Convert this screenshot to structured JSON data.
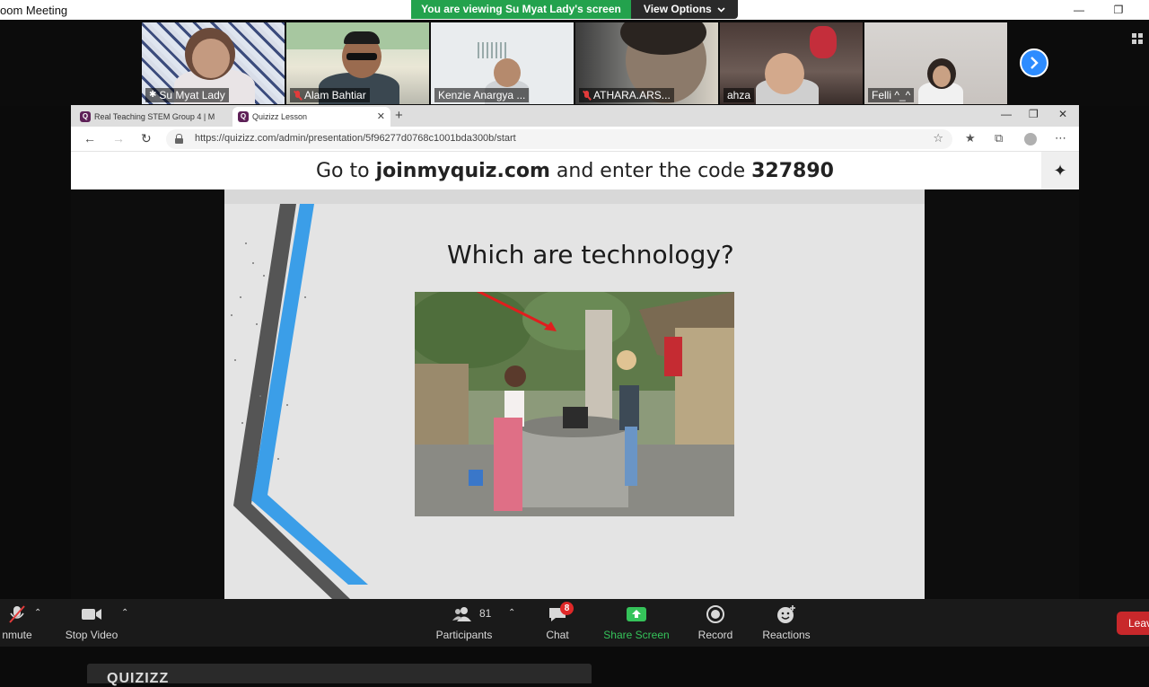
{
  "window": {
    "title": "oom Meeting",
    "minimize_glyph": "—",
    "restore_glyph": "❐"
  },
  "share_banner": {
    "text": "You are viewing Su Myat Lady's screen",
    "view_options": "View Options",
    "view_options_icon": "chevron-down"
  },
  "participants": [
    {
      "name": "Su Myat Lady",
      "muted": false,
      "pinned": true,
      "active_speaker": true
    },
    {
      "name": "Alam Bahtiar",
      "muted": true
    },
    {
      "name": "Kenzie Anargya ...",
      "muted": false
    },
    {
      "name": "ATHARA.ARS...",
      "muted": true
    },
    {
      "name": "ahza",
      "muted": false
    },
    {
      "name": "Felli ^_^",
      "muted": false
    }
  ],
  "strip_next_button_icon": "chevron-right",
  "browser": {
    "tabs": [
      {
        "title": "Real Teaching STEM Group 4 | M",
        "active": false
      },
      {
        "title": "Quizizz Lesson",
        "active": true
      }
    ],
    "tab_favicon_letter": "Q",
    "url": "https://quizizz.com/admin/presentation/5f96277d0768c1001bda300b/start",
    "window_glyphs": {
      "minimize": "—",
      "maximize": "❐",
      "close": "✕"
    }
  },
  "quiz": {
    "join_prefix": "Go to ",
    "join_site": "joinmyquiz.com",
    "join_middle": " and enter the code ",
    "join_code": "327890",
    "slide_title": "Which are technology?",
    "logo_text": "QUIZIZZ"
  },
  "controls": {
    "mute_label": "nmute",
    "video_label": "Stop Video",
    "participants_label": "Participants",
    "participants_count": "81",
    "chat_label": "Chat",
    "chat_badge": "8",
    "share_label": "Share Screen",
    "record_label": "Record",
    "reactions_label": "Reactions",
    "leave_label": "Leav"
  },
  "colors": {
    "zoom_green": "#23a24d",
    "zoom_blue": "#2d8cff",
    "leave_red": "#c8282b",
    "quizizz_purple": "#5d2057"
  }
}
